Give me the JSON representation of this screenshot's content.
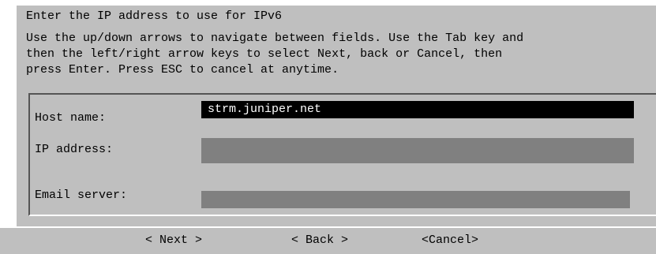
{
  "dialog": {
    "title": "Enter the IP address to use for IPv6",
    "instructions": [
      "Use the up/down arrows to navigate between fields. Use the Tab key and",
      "then the left/right arrow keys to select Next, back or Cancel, then",
      "press Enter. Press ESC to cancel at anytime."
    ]
  },
  "fields": [
    {
      "label": "Host name:",
      "value": "strm.juniper.net",
      "active": true
    },
    {
      "label": "IP address:",
      "value": "",
      "active": false
    },
    {
      "label": "Email server:",
      "value": "",
      "active": false
    }
  ],
  "buttons": {
    "next": "< Next >",
    "back": "< Back >",
    "cancel": "<Cancel>"
  },
  "colors": {
    "dialog_background": "#bfbfbf",
    "input_background": "#808080",
    "active_input_background": "#000000",
    "active_input_text": "#ffffff"
  }
}
